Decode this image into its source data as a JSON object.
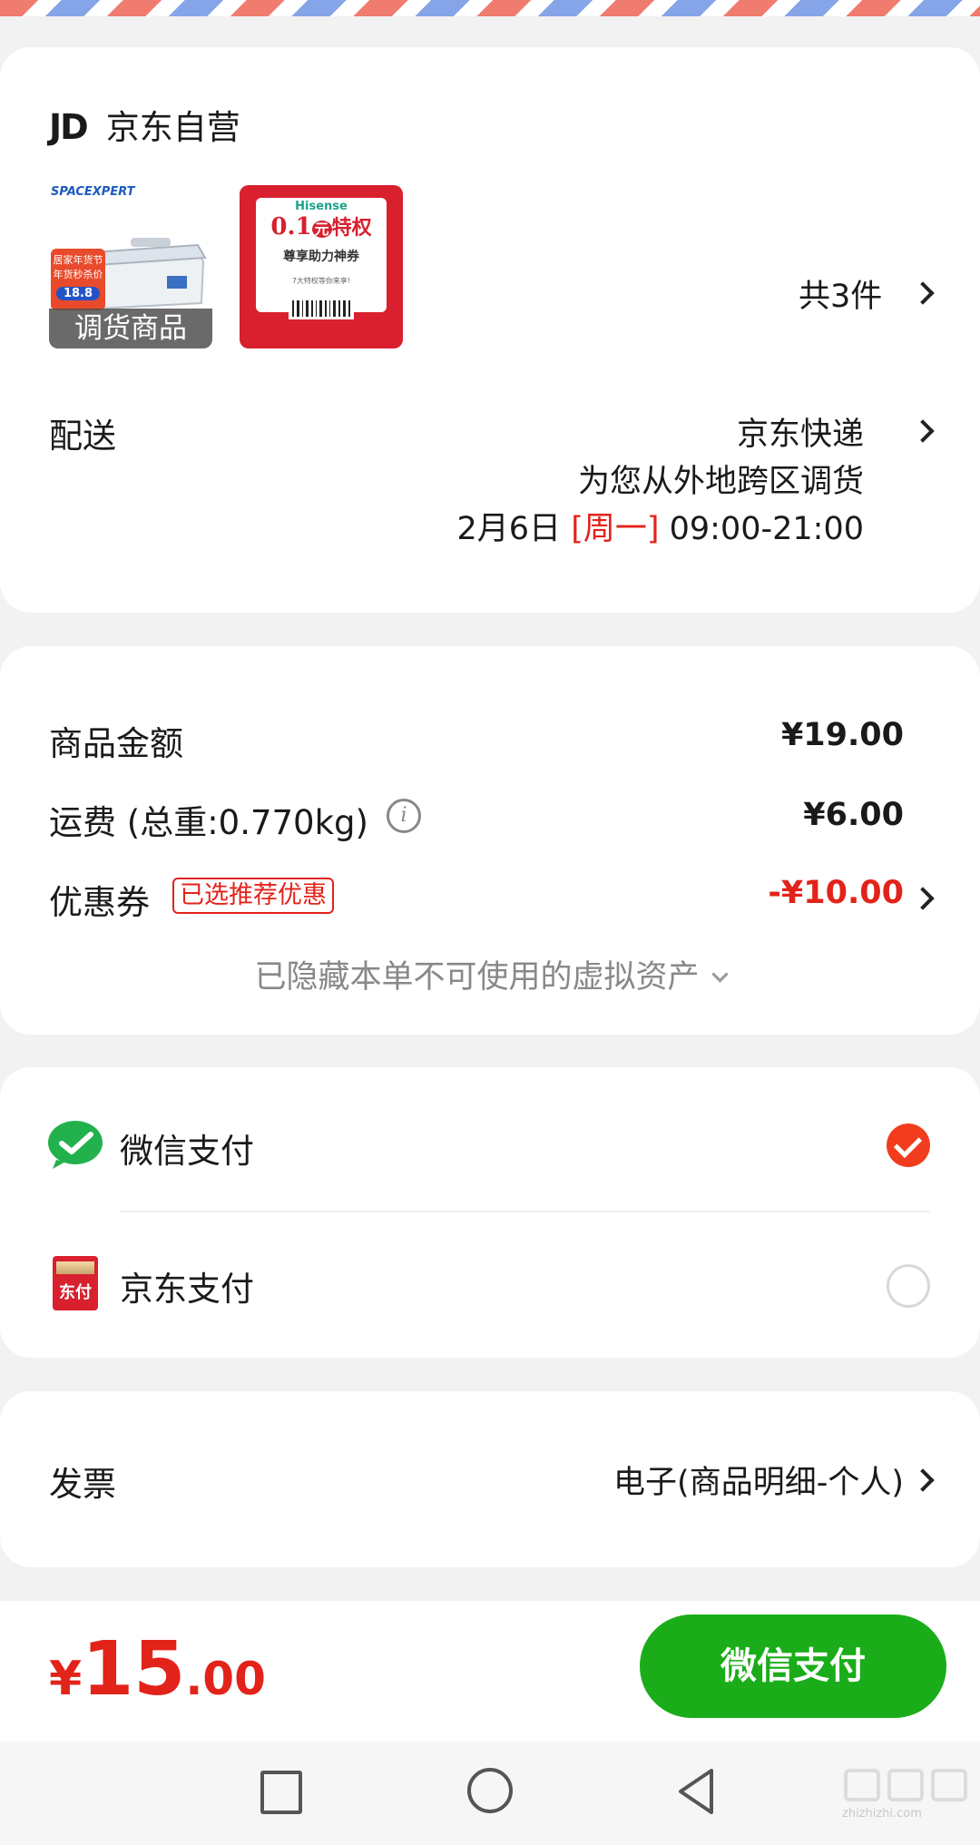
{
  "store": {
    "logo": "JD",
    "name": "京东自营"
  },
  "products": {
    "transfer_label": "调货商品",
    "box_brand": "SPACEXPERT",
    "box_badge_top": "居家年货节",
    "box_badge_mid": "年货秒杀价",
    "box_price": "18.8",
    "coupon_brand": "Hisense",
    "coupon_title_num": "0.1",
    "coupon_title_unit": "元",
    "coupon_title_rest": "特权",
    "coupon_subtitle": "尊享助力神券",
    "coupon_fine": "7大特权等你来享!",
    "count_label": "共3件"
  },
  "delivery": {
    "label": "配送",
    "method": "京东快递",
    "note": "为您从外地跨区调货",
    "date": "2月6日",
    "weekday": "[周一]",
    "time": "09:00-21:00"
  },
  "amounts": {
    "goods_label": "商品金额",
    "goods_value": "¥19.00",
    "shipping_label": "运费 (总重:0.770kg)",
    "shipping_value": "¥6.00",
    "coupon_label": "优惠券",
    "coupon_tag": "已选推荐优惠",
    "coupon_value": "-¥10.00",
    "hidden_assets": "已隐藏本单不可使用的虚拟资产"
  },
  "payment": {
    "wechat": "微信支付",
    "jdpay": "京东支付",
    "jdpay_icon_text": "东付",
    "selected": "wechat"
  },
  "invoice": {
    "label": "发票",
    "value": "电子(商品明细-个人)"
  },
  "footer": {
    "currency": "¥",
    "total_int": "15",
    "total_dec": ".00",
    "pay_button": "微信支付"
  },
  "watermark": {
    "text": "zhizhizhi.com"
  },
  "colors": {
    "accent_red": "#e2231a",
    "wechat_green": "#1aad19"
  }
}
